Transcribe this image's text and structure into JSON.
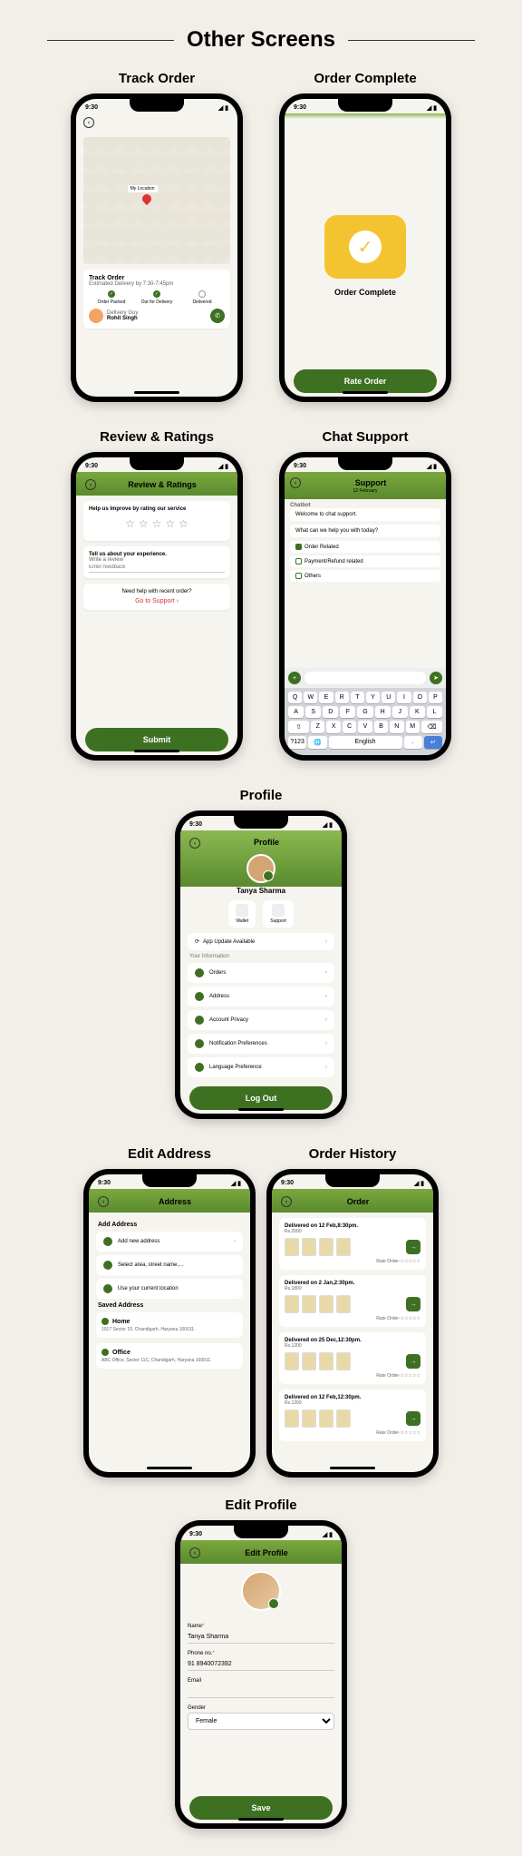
{
  "page_title": "Other Screens",
  "status_time": "9:30",
  "screens": {
    "track": {
      "label": "Track Order",
      "map_location": "My Location",
      "card_title": "Track Order",
      "eta": "Estimated Delivery by 7:30-7:45pm",
      "step1": "Order Packed",
      "step2": "Out for Delivery",
      "step3": "Delivered",
      "guy_label": "Delivery Guy",
      "guy_name": "Rohit Singh"
    },
    "complete": {
      "label": "Order Complete",
      "title": "Order Complete",
      "btn": "Rate Order"
    },
    "review": {
      "label": "Review & Ratings",
      "header": "Review & Ratings",
      "prompt1": "Help us Improve by rating our service",
      "prompt2": "Tell us about your experience.",
      "write": "Write a review",
      "placeholder": "Enter feedback",
      "help": "Need help with recent order?",
      "support_link": "Go to Support  ›",
      "submit": "Submit"
    },
    "chat": {
      "label": "Chat Support",
      "header": "Support",
      "date": "12 February",
      "bot_label": "Chatbot",
      "msg1": "Welcome to chat support.",
      "msg2": "What can we help you with today?",
      "opt1": "Order Related",
      "opt2": "Payment/Refund related",
      "opt3": "Others",
      "kbd_lang": "English"
    },
    "profile": {
      "label": "Profile",
      "header": "Profile",
      "name": "Tanya Sharma",
      "wallet": "Wallet",
      "support": "Support",
      "update": "App Update Available",
      "section": "Your Information",
      "items": [
        "Orders",
        "Address",
        "Account Privacy",
        "Notification Preferences",
        "Language Preference"
      ],
      "logout": "Log Out"
    },
    "address": {
      "label": "Edit Address",
      "header": "Address",
      "add_section": "Add Address",
      "add_new": "Add new address",
      "select_area": "Select area, street name,…",
      "use_location": "Use your current location",
      "saved_section": "Saved Address",
      "home": "Home",
      "home_addr": "1017 Sector 10, Chandigarh, Haryana 160011.",
      "office": "Office",
      "office_addr": "ABC Office, Sector 11C, Chandigarh, Haryana 160011."
    },
    "history": {
      "label": "Order History",
      "header": "Order",
      "orders": [
        {
          "title": "Delivered on 12 Feb,8:30pm.",
          "price": "Rs.2000",
          "rate": "Rate Order-"
        },
        {
          "title": "Delivered on 2 Jan,2:30pm.",
          "price": "Rs.1800",
          "rate": "Rate Order-"
        },
        {
          "title": "Delivered on 25 Dec,12:30pm.",
          "price": "Rs.1200",
          "rate": "Rate Order-"
        },
        {
          "title": "Delivered on 12 Feb,12:30pm.",
          "price": "Rs.1200",
          "rate": "Rate Order-"
        }
      ]
    },
    "edit_profile": {
      "label": "Edit Profile",
      "header": "Edit Profile",
      "name_label": "Name",
      "name_value": "Tanya Sharma",
      "phone_label": "Phone no.",
      "phone_value": "91 8940072392",
      "email_label": "Email",
      "gender_label": "Gender",
      "gender_value": "Female",
      "save": "Save"
    }
  }
}
